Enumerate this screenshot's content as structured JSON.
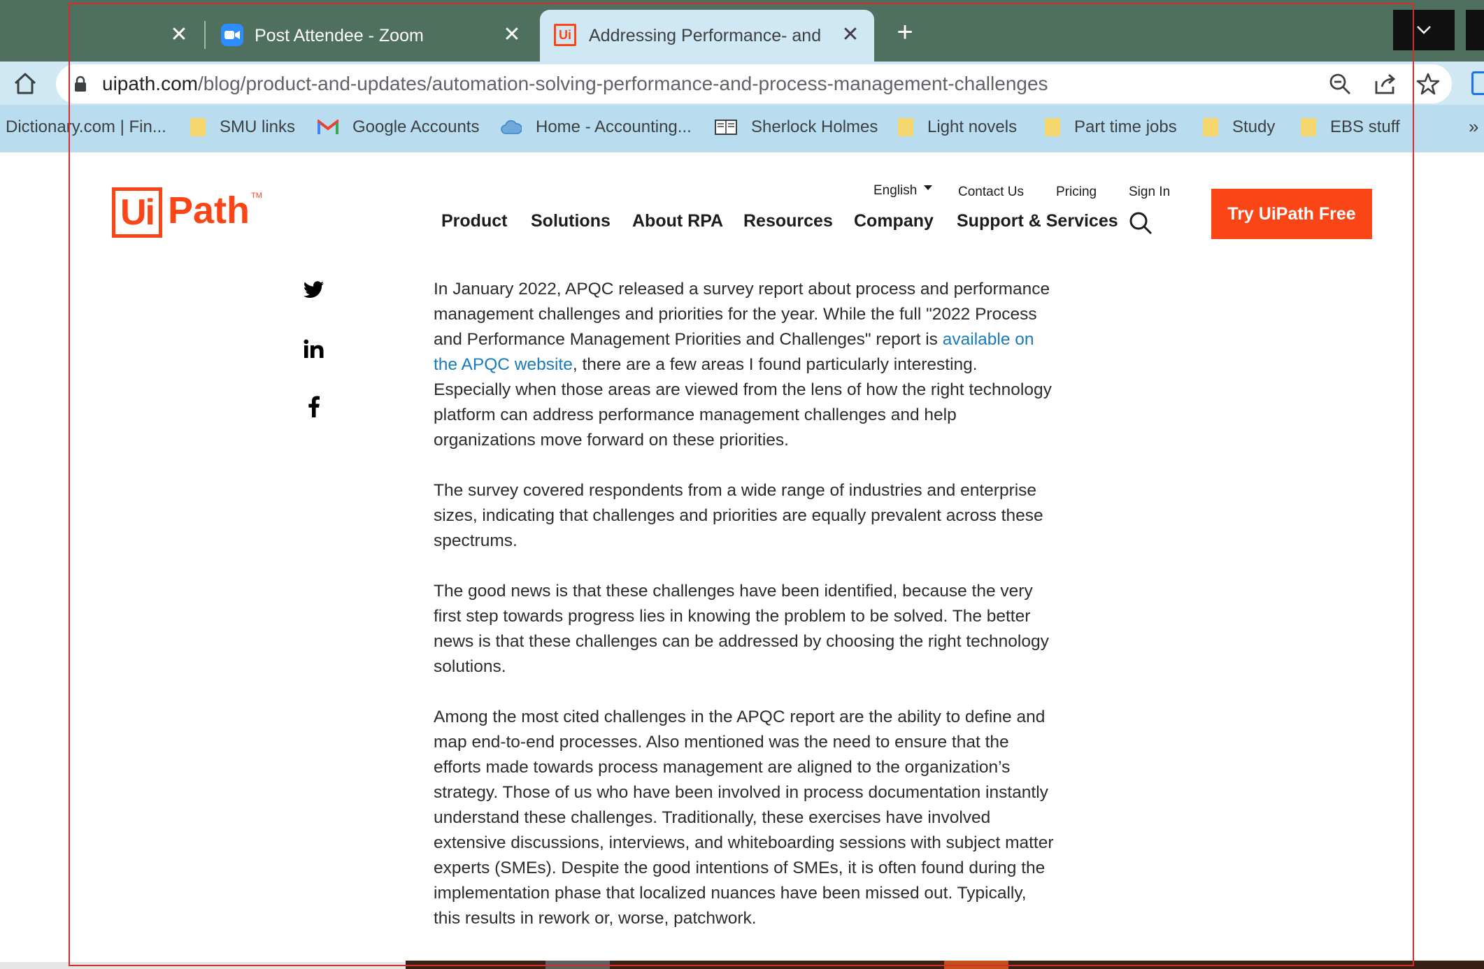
{
  "browser": {
    "tabs": [
      {
        "title": "",
        "active": false
      },
      {
        "title": "Post Attendee - Zoom",
        "active": false,
        "icon": "zoom-icon"
      },
      {
        "title": "Addressing Performance- and Pr",
        "active": true,
        "icon": "uipath-favicon"
      }
    ],
    "close_glyph": "✕",
    "new_tab_glyph": "+",
    "url_host": "uipath.com",
    "url_path": "/blog/product-and-updates/automation-solving-performance-and-process-management-challenges",
    "bookmarks": [
      {
        "label": "Dictionary.com | Fin...",
        "icon": ""
      },
      {
        "label": "SMU links",
        "icon": "folder-icon"
      },
      {
        "label": "Google Accounts",
        "icon": "gmail-icon"
      },
      {
        "label": "Home - Accounting...",
        "icon": "cloud-icon"
      },
      {
        "label": "Sherlock Holmes",
        "icon": "book-icon"
      },
      {
        "label": "Light novels",
        "icon": "folder-icon"
      },
      {
        "label": "Part time jobs",
        "icon": "folder-icon"
      },
      {
        "label": "Study",
        "icon": "folder-icon"
      },
      {
        "label": "EBS stuff",
        "icon": "folder-icon"
      }
    ],
    "bookmarks_more": "»",
    "colors": {
      "tab_strip": "#4f6f5f",
      "toolbar": "#d0e8f4",
      "bookmarks_bar": "#b9dcee"
    }
  },
  "site": {
    "logo_box": "Ui",
    "logo_text": "Path",
    "logo_tm": "TM",
    "utility": {
      "language": "English",
      "contact": "Contact Us",
      "pricing": "Pricing",
      "sign_in": "Sign In"
    },
    "nav": [
      "Product",
      "Solutions",
      "About RPA",
      "Resources",
      "Company",
      "Support & Services"
    ],
    "cta": "Try UiPath Free",
    "brand_color": "#fa4616",
    "share_icons": [
      "twitter-icon",
      "linkedin-icon",
      "facebook-icon"
    ]
  },
  "article": {
    "p1_before": "In January 2022, APQC released a survey report about process and performance management challenges and priorities for the year. While the full \"2022 Process and Performance Management Priorities and Challenges\" report is ",
    "p1_link": "available on the APQC website",
    "p1_after": ", there are a few areas I found particularly interesting. Especially when those areas are viewed from the lens of how the right technology platform can address performance management challenges and help organizations move forward on these priorities.",
    "p2": "The survey covered respondents from a wide range of industries and enterprise sizes, indicating that challenges and priorities are equally prevalent across these spectrums.",
    "p3": "The good news is that these challenges have been identified, because the very first step towards progress lies in knowing the problem to be solved. The better news is that these challenges can be addressed by choosing the right technology solutions.",
    "p4": "Among the most cited challenges in the APQC report are the ability to define and map end-to-end processes. Also mentioned was the need to ensure that the efforts made towards process management are aligned to the organization’s strategy. Those of us who have been involved in process documentation instantly understand these challenges. Traditionally, these exercises have involved extensive discussions, interviews, and whiteboarding sessions with subject matter experts (SMEs). Despite the good intentions of SMEs, it is often found during the implementation phase that localized nuances have been missed out. Typically, this results in rework or, worse, patchwork."
  }
}
